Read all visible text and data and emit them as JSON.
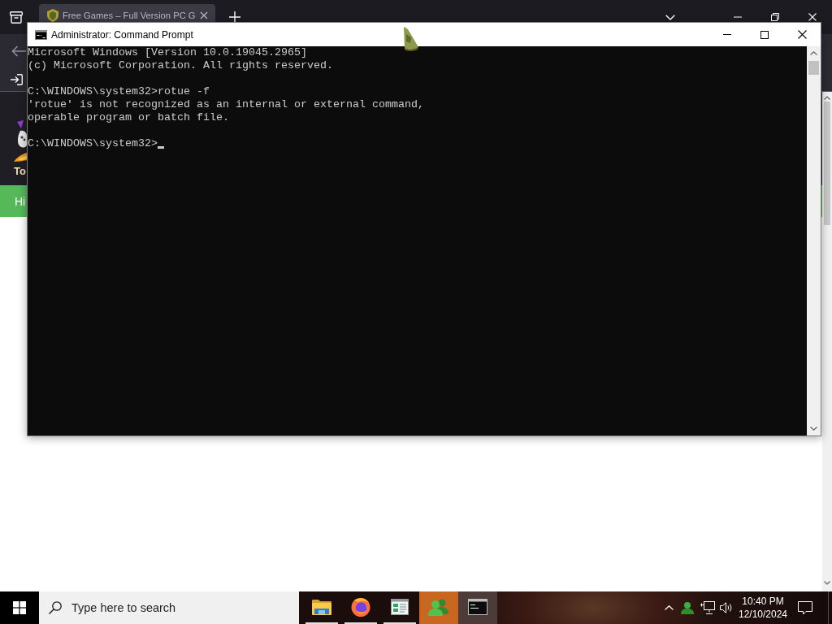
{
  "browser": {
    "tab": {
      "title": "Free Games – Full Version PC G",
      "selected": true
    },
    "page": {
      "header_text": "To",
      "banner_text": "Hi"
    }
  },
  "window": {
    "title": "Administrator: Command Prompt",
    "console": {
      "blocks": [
        [
          "Microsoft Windows [Version 10.0.19045.2965]",
          "(c) Microsoft Corporation. All rights reserved."
        ],
        [
          "C:\\WINDOWS\\system32>rotue -f",
          "'rotue' is not recognized as an internal or external command,",
          "operable program or batch file."
        ],
        [
          "C:\\WINDOWS\\system32>"
        ]
      ],
      "cursor": true
    }
  },
  "taskbar": {
    "search": {
      "placeholder": "Type here to search"
    },
    "apps": [
      {
        "kind": "folder",
        "running": true,
        "flashing": false,
        "selected": false
      },
      {
        "kind": "globe",
        "running": true,
        "flashing": false,
        "selected": false
      },
      {
        "kind": "window",
        "running": true,
        "flashing": false,
        "selected": false
      },
      {
        "kind": "people",
        "running": false,
        "flashing": true,
        "selected": false
      },
      {
        "kind": "terminal",
        "running": false,
        "flashing": false,
        "selected": true
      }
    ],
    "tray": {
      "time": "10:40 PM",
      "date": "12/10/2024"
    }
  }
}
